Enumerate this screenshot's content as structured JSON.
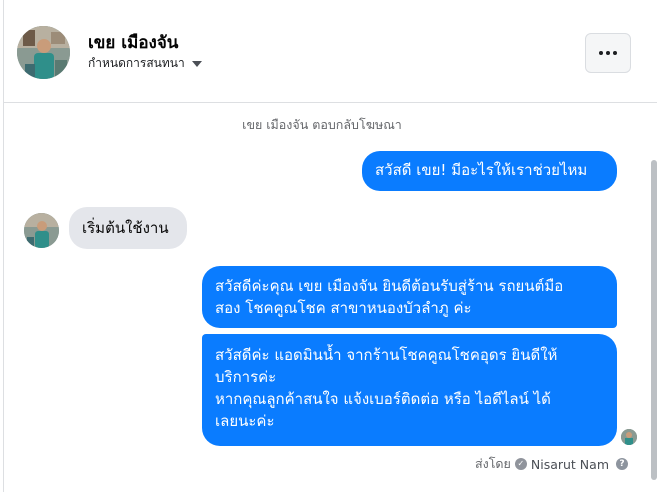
{
  "header": {
    "contact_name": "เขย เมืองจัน",
    "settings_label": "กำหนดการสนทนา",
    "more_button_icon": "more-horizontal-icon"
  },
  "thread": {
    "system_note": "เขย เมืองจัน ตอบกลับโฆษณา",
    "messages": [
      {
        "direction": "outgoing",
        "lines": [
          "สวัสดี เขย! มีอะไรให้เราช่วยไหม"
        ]
      },
      {
        "direction": "incoming",
        "lines": [
          "เริ่มต้นใช้งาน"
        ]
      },
      {
        "direction": "outgoing",
        "lines": [
          "สวัสดีค่ะคุณ เขย เมืองจัน ยินดีต้อนรับสู่ร้าน รถยนต์มือ",
          "สอง โชคคูณโชค สาขาหนองบัวลำภู ค่ะ"
        ]
      },
      {
        "direction": "outgoing",
        "lines": [
          "สวัสดีค่ะ แอดมินน้ำ จากร้านโชคคูณโชคอุดร ยินดีให้",
          "บริการค่ะ",
          "หากคุณลูกค้าสนใจ แจ้งเบอร์ติดต่อ หรือ ไอดีไลน์ ได้",
          "เลยนะค่ะ"
        ]
      }
    ],
    "sent_by_label": "ส่งโดย",
    "sent_by_name": "Nisarut Nam"
  },
  "colors": {
    "outgoing_bubble": "#0a7cff",
    "incoming_bubble": "#e4e6eb",
    "muted_text": "#65676b"
  }
}
